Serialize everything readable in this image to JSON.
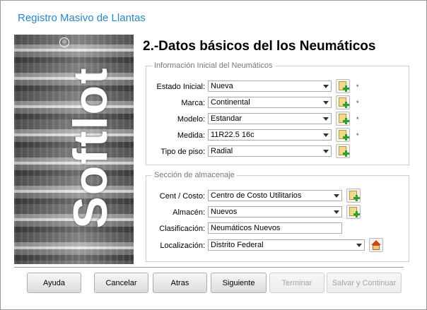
{
  "window": {
    "title": "Registro Masivo de Llantas"
  },
  "side_panel": {
    "logo_text": "Softlot",
    "registered_mark": "®"
  },
  "page_heading": "2.-Datos básicos del los Neumáticos",
  "section_initial": {
    "legend": "Información Inicial del Neumáticos",
    "fields": [
      {
        "label": "Estado Inicial:",
        "value": "Nueva",
        "required": "*"
      },
      {
        "label": "Marca:",
        "value": "Continental",
        "required": "*"
      },
      {
        "label": "Modelo:",
        "value": "Estandar",
        "required": "*"
      },
      {
        "label": "Medida:",
        "value": "11R22.5 16c",
        "required": "*"
      },
      {
        "label": "Tipo de piso:",
        "value": "Radial"
      }
    ]
  },
  "section_storage": {
    "legend": "Sección de almacenaje",
    "fields": [
      {
        "label": "Cent / Costo:",
        "value": "Centro de Costo Utilitarios"
      },
      {
        "label": "Almacén:",
        "value": "Nuevos"
      },
      {
        "label": "Clasificación:",
        "value": "Neumáticos Nuevos"
      },
      {
        "label": "Localización:",
        "value": "Distrito Federal"
      }
    ]
  },
  "buttons": {
    "help": "Ayuda",
    "cancel": "Cancelar",
    "back": "Atras",
    "next": "Siguiente",
    "finish": "Terminar",
    "save_continue": "Salvar y Continuar"
  },
  "icons": {
    "add_button": "document-add-icon",
    "location_button": "home-icon",
    "combo_arrow": "chevron-down-icon"
  }
}
